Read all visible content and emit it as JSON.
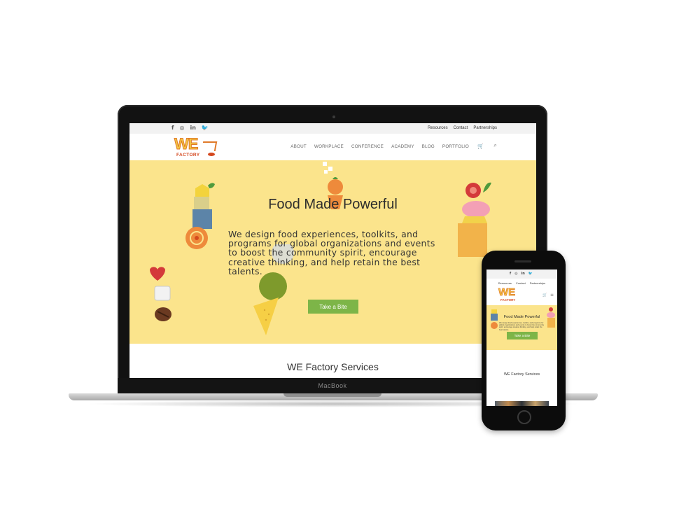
{
  "laptop": {
    "brand": "MacBook",
    "topbar": {
      "social": [
        {
          "icon": "facebook-icon",
          "glyph": "f"
        },
        {
          "icon": "instagram-icon",
          "glyph": "◎"
        },
        {
          "icon": "linkedin-icon",
          "glyph": "in"
        },
        {
          "icon": "twitter-icon",
          "glyph": "🐦"
        }
      ],
      "links": [
        "Resources",
        "Contact",
        "Partnerships"
      ]
    },
    "logo": {
      "line1": "WE",
      "line2": "FACTORY"
    },
    "nav": [
      "ABOUT",
      "WORKPLACE",
      "CONFERENCE",
      "ACADEMY",
      "BLOG",
      "PORTFOLIO"
    ],
    "cart_glyph": "🛒",
    "search_glyph": "⌕",
    "hero": {
      "title": "Food Made Powerful",
      "text": "We design food experiences, toolkits, and programs for global organizations and events to boost the community spirit, encourage creative thinking, and help retain the best talents.",
      "button": "Take a Bite",
      "background": "#fbe48c",
      "button_color": "#7db548"
    },
    "section_title": "WE Factory Services"
  },
  "phone": {
    "topbar": {
      "social": [
        "f",
        "◎",
        "in",
        "🐦"
      ],
      "links": [
        "Resources",
        "Contact",
        "Partnerships"
      ]
    },
    "logo": {
      "line1": "WE",
      "line2": "FACTORY"
    },
    "cart_glyph": "🛒",
    "menu_glyph": "≡",
    "hero": {
      "title": "Food Made Powerful",
      "text": "We design food experiences, toolkits, and programs for global organizations and events to boost the community spirit, encourage creative thinking, and help retain the best talents.",
      "button": "Take a Bite"
    },
    "section_title": "WE Factory Services"
  }
}
